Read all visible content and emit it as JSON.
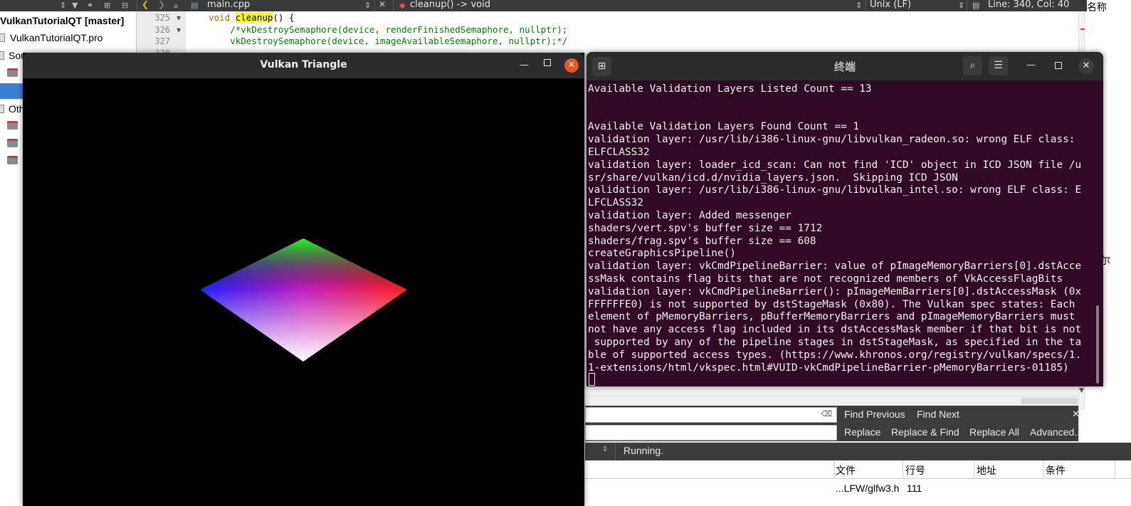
{
  "ide": {
    "file_name": "main.cpp",
    "function_crumb": "cleanup() -> void",
    "line_ending": "Unix (LF)",
    "cursor_pos": "Line: 340, Col: 40",
    "right_header": "名称",
    "project_title": "VulkanTutorialQT [master]",
    "project_file": "VulkanTutorialQT.pro",
    "project_sources": "Sou",
    "project_other": "Oth",
    "right_strip_text": "尔",
    "code": {
      "line1_no": "325",
      "line2_no": "326",
      "line3_no": "327",
      "line4_no": "328",
      "line1_indent": "    ",
      "line1_kw": "void",
      "line1_fn": "cleanup",
      "line1_tail": "() {",
      "line2_text": "        /*vkDestroySemaphore(device, renderFinishedSemaphore, nullptr);",
      "line3_text": "        vkDestroySemaphore(device, imageAvailableSemaphore, nullptr);*/"
    },
    "find": {
      "find_previous": "Find Previous",
      "find_next": "Find Next",
      "replace": "Replace",
      "replace_find": "Replace & Find",
      "replace_all": "Replace All",
      "advanced": "Advanced..."
    },
    "run_status": "Running.",
    "table": {
      "headers": [
        "文件",
        "行号",
        "地址",
        "条件"
      ],
      "row": {
        "file": "...LFW/glfw3.h",
        "line": "111"
      }
    }
  },
  "vulkan_window": {
    "title": "Vulkan Triangle"
  },
  "terminal": {
    "title": "终端",
    "lines": [
      "Available Validation Layers Listed Count == 13",
      "",
      "",
      "Available Validation Layers Found Count == 1",
      "validation layer: /usr/lib/i386-linux-gnu/libvulkan_radeon.so: wrong ELF class:",
      "ELFCLASS32",
      "validation layer: loader_icd_scan: Can not find 'ICD' object in ICD JSON file /u",
      "sr/share/vulkan/icd.d/nvidia_layers.json.  Skipping ICD JSON",
      "validation layer: /usr/lib/i386-linux-gnu/libvulkan_intel.so: wrong ELF class: E",
      "LFCLASS32",
      "validation layer: Added messenger",
      "shaders/vert.spv's buffer size == 1712",
      "shaders/frag.spv's buffer size == 608",
      "createGraphicsPipeline()",
      "validation layer: vkCmdPipelineBarrier: value of pImageMemoryBarriers[0].dstAcce",
      "ssMask contains flag bits that are not recognized members of VkAccessFlagBits",
      "validation layer: vkCmdPipelineBarrier(): pImageMemBarriers[0].dstAccessMask (0x",
      "FFFFFFE0) is not supported by dstStageMask (0x80). The Vulkan spec states: Each",
      "element of pMemoryBarriers, pBufferMemoryBarriers and pImageMemoryBarriers must",
      "not have any access flag included in its dstAccessMask member if that bit is not",
      " supported by any of the pipeline stages in dstStageMask, as specified in the ta",
      "ble of supported access types. (https://www.khronos.org/registry/vulkan/specs/1.",
      "1-extensions/html/vkspec.html#VUID-vkCmdPipelineBarrier-pMemoryBarriers-01185)"
    ]
  },
  "colors": {
    "terminal_bg": "#300a24",
    "ubuntu_orange": "#e95420",
    "title_bar": "#2c2c2c"
  }
}
